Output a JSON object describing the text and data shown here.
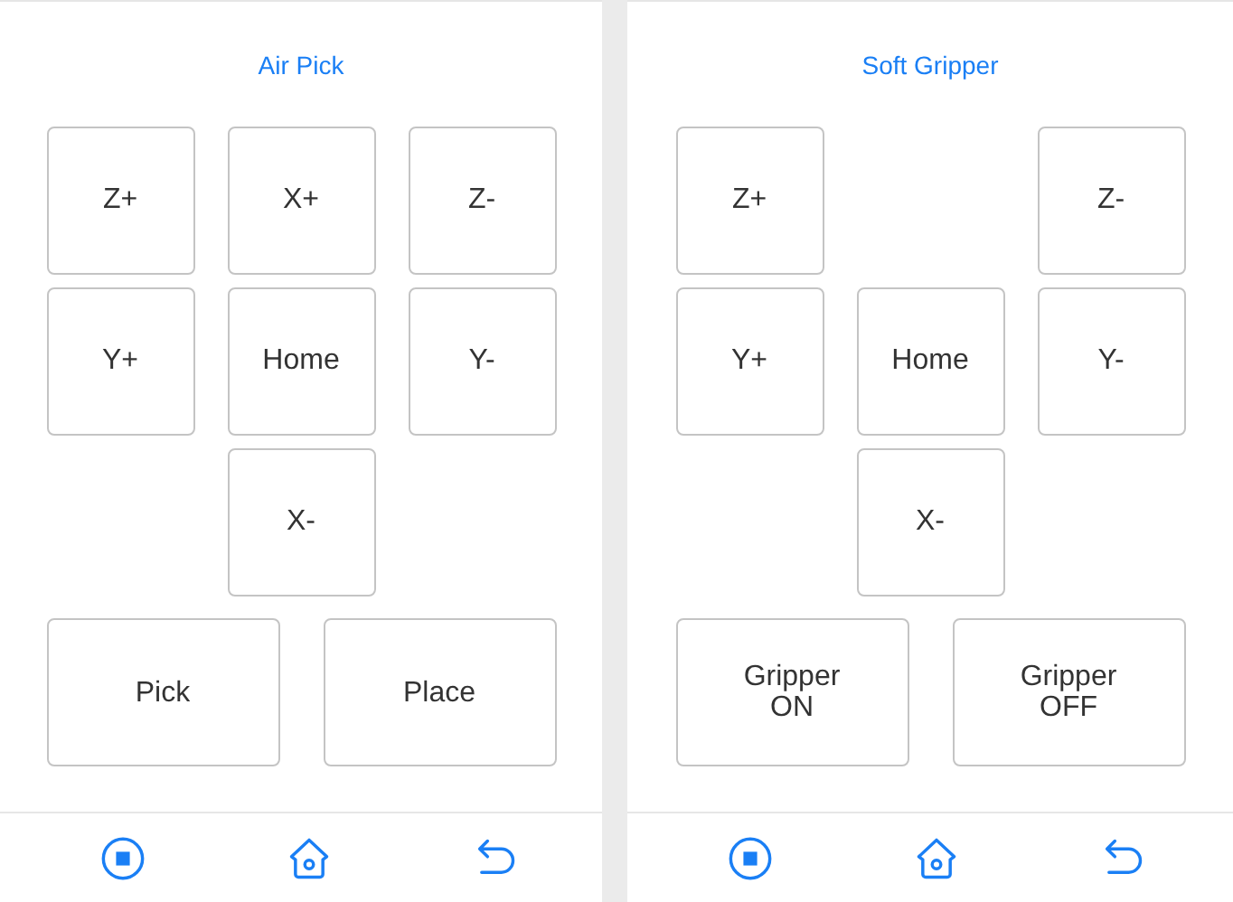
{
  "panels": [
    {
      "title": "Air Pick",
      "keys": [
        {
          "kind": "key",
          "label": "Z+"
        },
        {
          "kind": "key",
          "label": "X+"
        },
        {
          "kind": "key",
          "label": "Z-"
        },
        {
          "kind": "key",
          "label": "Y+"
        },
        {
          "kind": "key",
          "label": "Home"
        },
        {
          "kind": "key",
          "label": "Y-"
        },
        {
          "kind": "gap"
        },
        {
          "kind": "key",
          "label": "X-"
        },
        {
          "kind": "gap"
        }
      ],
      "actions": [
        "Pick",
        "Place"
      ]
    },
    {
      "title": "Soft Gripper",
      "keys": [
        {
          "kind": "key",
          "label": "Z+"
        },
        {
          "kind": "gap"
        },
        {
          "kind": "key",
          "label": "Z-"
        },
        {
          "kind": "key",
          "label": "Y+"
        },
        {
          "kind": "key",
          "label": "Home"
        },
        {
          "kind": "key",
          "label": "Y-"
        },
        {
          "kind": "gap"
        },
        {
          "kind": "key",
          "label": "X-"
        },
        {
          "kind": "gap"
        }
      ],
      "actions": [
        "Gripper ON",
        "Gripper OFF"
      ]
    }
  ]
}
